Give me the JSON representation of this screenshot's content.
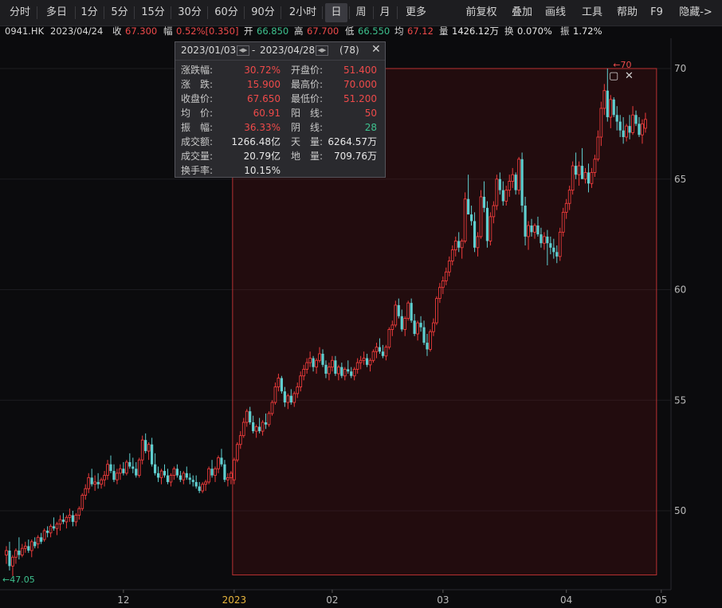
{
  "toolbar": {
    "periods": [
      "分时",
      "多日",
      "1分",
      "5分",
      "15分",
      "30分",
      "60分",
      "90分",
      "2小时",
      "日",
      "周",
      "月",
      "更多"
    ],
    "active_period": "日",
    "right": [
      "前复权",
      "叠加",
      "画线",
      "工具",
      "帮助",
      "F9",
      "隐藏->"
    ]
  },
  "info": {
    "symbol": "0941.HK",
    "date": "2023/04/24",
    "close_label": "收",
    "close": "67.300",
    "amp_label": "幅",
    "amp": "0.52%[0.350]",
    "open_label": "开",
    "open": "66.850",
    "high_label": "高",
    "high": "67.700",
    "low_label": "低",
    "low": "66.550",
    "avg_label": "均",
    "avg": "67.12",
    "vol_label": "量",
    "vol": "1426.12万",
    "turn_label": "换",
    "turn": "0.070%",
    "swing_label": "振",
    "swing": "1.72%"
  },
  "tooltip": {
    "start": "2023/01/03",
    "end": "2023/04/28",
    "count": "(78)",
    "left_rows": [
      {
        "label": "涨跌幅:",
        "value": "30.72%",
        "color": "red"
      },
      {
        "label": "涨　跌:",
        "value": "15.900",
        "color": "red"
      },
      {
        "label": "收盘价:",
        "value": "67.650",
        "color": "red"
      },
      {
        "label": "均　价:",
        "value": "60.91",
        "color": "red"
      },
      {
        "label": "振　幅:",
        "value": "36.33%",
        "color": "red"
      },
      {
        "label": "成交额:",
        "value": "1266.48亿",
        "color": "white"
      },
      {
        "label": "成交量:",
        "value": "20.79亿",
        "color": "white"
      },
      {
        "label": "换手率:",
        "value": "10.15%",
        "color": "white"
      }
    ],
    "right_rows": [
      {
        "label": "开盘价:",
        "value": "51.400",
        "color": "red"
      },
      {
        "label": "最高价:",
        "value": "70.000",
        "color": "red"
      },
      {
        "label": "最低价:",
        "value": "51.200",
        "color": "red"
      },
      {
        "label": "阳　线:",
        "value": "50",
        "color": "red"
      },
      {
        "label": "阴　线:",
        "value": "28",
        "color": "green"
      },
      {
        "label": "天　量:",
        "value": "6264.57万",
        "color": "white"
      },
      {
        "label": "地　量:",
        "value": "709.76万",
        "color": "white"
      }
    ]
  },
  "chart_data": {
    "type": "candlestick",
    "ylim": [
      46.5,
      70.6
    ],
    "y_ticks": [
      50,
      55,
      60,
      65,
      70
    ],
    "x_ticks": [
      {
        "label": "12",
        "index": 37,
        "highlight": false
      },
      {
        "label": "2023",
        "index": 72,
        "highlight": true
      },
      {
        "label": "02",
        "index": 103,
        "highlight": false
      },
      {
        "label": "03",
        "index": 138,
        "highlight": false
      },
      {
        "label": "04",
        "index": 177,
        "highlight": false
      },
      {
        "label": "05",
        "index": 207,
        "highlight": false
      }
    ],
    "annotations": {
      "max_label": "70",
      "max_value": 70.0,
      "max_index": 192,
      "min_label": "47.05",
      "min_value": 47.05,
      "min_index": 2
    },
    "selection": {
      "start_index": 72,
      "end_index": 205,
      "top_value": 70.0,
      "bottom_value": 47.1
    },
    "ohlc": [
      [
        48.0,
        48.4,
        47.6,
        48.2
      ],
      [
        48.2,
        48.6,
        47.3,
        47.5
      ],
      [
        47.5,
        48.0,
        47.05,
        47.9
      ],
      [
        47.9,
        48.3,
        47.6,
        48.2
      ],
      [
        48.2,
        48.8,
        47.8,
        48.0
      ],
      [
        48.0,
        48.5,
        47.9,
        48.3
      ],
      [
        48.3,
        48.6,
        48.1,
        48.4
      ],
      [
        48.4,
        48.7,
        48.1,
        48.2
      ],
      [
        48.2,
        48.7,
        47.9,
        48.6
      ],
      [
        48.6,
        48.8,
        48.3,
        48.4
      ],
      [
        48.5,
        48.9,
        48.3,
        48.8
      ],
      [
        48.8,
        49.0,
        48.5,
        48.6
      ],
      [
        48.7,
        49.2,
        48.6,
        49.1
      ],
      [
        49.1,
        49.3,
        48.8,
        49.0
      ],
      [
        49.0,
        49.4,
        48.8,
        49.3
      ],
      [
        49.3,
        49.7,
        49.1,
        49.2
      ],
      [
        49.2,
        49.5,
        48.9,
        49.4
      ],
      [
        49.4,
        49.8,
        49.1,
        49.6
      ],
      [
        49.6,
        49.9,
        49.4,
        49.5
      ],
      [
        49.5,
        49.8,
        49.2,
        49.7
      ],
      [
        49.7,
        50.1,
        49.5,
        49.8
      ],
      [
        49.8,
        50.0,
        49.3,
        49.5
      ],
      [
        49.5,
        49.9,
        49.3,
        49.8
      ],
      [
        49.8,
        50.2,
        49.6,
        50.1
      ],
      [
        50.1,
        50.8,
        50.0,
        50.7
      ],
      [
        50.7,
        51.2,
        50.5,
        51.0
      ],
      [
        51.0,
        51.7,
        50.8,
        51.5
      ],
      [
        51.5,
        51.9,
        51.1,
        51.2
      ],
      [
        51.2,
        51.6,
        50.9,
        51.3
      ],
      [
        51.3,
        51.7,
        51.0,
        51.2
      ],
      [
        51.2,
        51.5,
        51.0,
        51.4
      ],
      [
        51.4,
        51.8,
        51.1,
        51.6
      ],
      [
        51.6,
        52.3,
        51.4,
        52.1
      ],
      [
        52.1,
        52.5,
        51.7,
        51.8
      ],
      [
        51.8,
        52.1,
        51.3,
        51.4
      ],
      [
        51.4,
        51.9,
        51.2,
        51.7
      ],
      [
        51.7,
        52.1,
        51.4,
        51.9
      ],
      [
        51.9,
        52.2,
        51.6,
        51.7
      ],
      [
        51.7,
        52.3,
        51.6,
        52.2
      ],
      [
        52.2,
        52.6,
        51.9,
        52.0
      ],
      [
        52.0,
        52.4,
        51.7,
        51.9
      ],
      [
        51.9,
        52.2,
        51.5,
        51.6
      ],
      [
        51.6,
        52.4,
        51.5,
        52.3
      ],
      [
        52.3,
        53.4,
        52.1,
        53.2
      ],
      [
        53.2,
        53.5,
        52.6,
        52.7
      ],
      [
        52.7,
        53.1,
        52.3,
        53.0
      ],
      [
        53.0,
        53.3,
        52.0,
        52.1
      ],
      [
        52.1,
        52.6,
        51.6,
        51.7
      ],
      [
        51.7,
        52.0,
        51.3,
        51.5
      ],
      [
        51.5,
        51.9,
        51.2,
        51.8
      ],
      [
        51.8,
        52.1,
        51.5,
        51.6
      ],
      [
        51.6,
        51.9,
        51.2,
        51.3
      ],
      [
        51.3,
        51.7,
        51.1,
        51.6
      ],
      [
        51.6,
        52.0,
        51.4,
        51.9
      ],
      [
        51.9,
        52.1,
        51.5,
        51.6
      ],
      [
        51.6,
        51.8,
        51.3,
        51.4
      ],
      [
        51.4,
        51.8,
        51.2,
        51.7
      ],
      [
        51.7,
        52.0,
        51.4,
        51.5
      ],
      [
        51.5,
        51.7,
        51.2,
        51.4
      ],
      [
        51.4,
        51.6,
        51.1,
        51.3
      ],
      [
        51.3,
        51.6,
        51.0,
        51.1
      ],
      [
        51.1,
        51.3,
        50.8,
        50.9
      ],
      [
        50.9,
        51.3,
        50.8,
        51.2
      ],
      [
        51.2,
        51.4,
        50.9,
        51.3
      ],
      [
        51.3,
        52.0,
        51.2,
        51.9
      ],
      [
        51.9,
        52.3,
        51.5,
        51.6
      ],
      [
        51.6,
        52.0,
        51.3,
        51.9
      ],
      [
        51.9,
        52.5,
        51.7,
        52.4
      ],
      [
        52.4,
        52.8,
        52.0,
        52.1
      ],
      [
        52.1,
        52.3,
        51.3,
        51.4
      ],
      [
        51.4,
        51.7,
        51.1,
        51.5
      ],
      [
        51.5,
        51.8,
        51.2,
        51.7
      ],
      [
        51.4,
        52.4,
        51.2,
        52.3
      ],
      [
        52.3,
        53.1,
        52.2,
        53.0
      ],
      [
        53.0,
        53.6,
        52.8,
        53.4
      ],
      [
        53.4,
        54.2,
        53.3,
        54.0
      ],
      [
        54.0,
        54.6,
        53.8,
        54.5
      ],
      [
        54.5,
        54.7,
        53.9,
        54.0
      ],
      [
        54.0,
        54.3,
        53.5,
        53.6
      ],
      [
        53.6,
        53.9,
        53.3,
        53.8
      ],
      [
        53.8,
        54.2,
        53.5,
        53.6
      ],
      [
        53.6,
        54.1,
        53.4,
        54.0
      ],
      [
        54.0,
        54.4,
        53.7,
        53.9
      ],
      [
        53.9,
        54.5,
        53.8,
        54.4
      ],
      [
        54.4,
        55.0,
        54.3,
        54.9
      ],
      [
        54.9,
        55.8,
        54.8,
        55.6
      ],
      [
        55.6,
        56.2,
        55.4,
        56.0
      ],
      [
        56.0,
        56.1,
        55.3,
        55.4
      ],
      [
        55.4,
        55.6,
        54.7,
        54.9
      ],
      [
        54.9,
        55.3,
        54.6,
        55.2
      ],
      [
        55.2,
        55.5,
        54.8,
        54.9
      ],
      [
        54.9,
        55.4,
        54.7,
        55.3
      ],
      [
        55.3,
        55.8,
        55.1,
        55.6
      ],
      [
        55.6,
        56.3,
        55.4,
        56.1
      ],
      [
        56.1,
        56.6,
        55.9,
        56.4
      ],
      [
        56.4,
        56.9,
        56.2,
        56.7
      ],
      [
        56.7,
        57.2,
        56.5,
        56.9
      ],
      [
        56.9,
        57.0,
        56.3,
        56.5
      ],
      [
        56.5,
        56.9,
        56.2,
        56.8
      ],
      [
        56.8,
        57.4,
        56.7,
        57.1
      ],
      [
        57.1,
        57.3,
        56.5,
        56.6
      ],
      [
        56.6,
        56.8,
        56.0,
        56.2
      ],
      [
        56.2,
        56.7,
        55.9,
        56.5
      ],
      [
        56.5,
        57.0,
        56.3,
        56.8
      ],
      [
        56.8,
        57.0,
        56.1,
        56.2
      ],
      [
        56.2,
        56.6,
        55.9,
        56.5
      ],
      [
        56.5,
        56.7,
        56.0,
        56.1
      ],
      [
        56.1,
        56.5,
        55.9,
        56.4
      ],
      [
        56.4,
        56.8,
        56.2,
        56.3
      ],
      [
        56.3,
        56.5,
        56.0,
        56.1
      ],
      [
        56.1,
        56.5,
        55.9,
        56.4
      ],
      [
        56.4,
        56.9,
        56.2,
        56.7
      ],
      [
        56.7,
        57.0,
        56.4,
        56.8
      ],
      [
        56.8,
        57.2,
        56.6,
        56.9
      ],
      [
        56.9,
        57.1,
        56.5,
        56.6
      ],
      [
        56.6,
        56.9,
        56.3,
        56.8
      ],
      [
        56.8,
        57.3,
        56.7,
        57.2
      ],
      [
        57.2,
        57.6,
        56.9,
        57.4
      ],
      [
        57.4,
        57.8,
        57.1,
        57.2
      ],
      [
        57.2,
        57.5,
        56.9,
        57.0
      ],
      [
        57.0,
        57.5,
        56.8,
        57.4
      ],
      [
        57.4,
        58.3,
        57.3,
        58.2
      ],
      [
        58.2,
        58.6,
        57.9,
        58.4
      ],
      [
        58.4,
        59.5,
        58.3,
        59.3
      ],
      [
        59.3,
        59.6,
        58.7,
        58.8
      ],
      [
        58.8,
        59.1,
        58.1,
        58.2
      ],
      [
        58.2,
        58.8,
        57.9,
        58.7
      ],
      [
        58.7,
        59.5,
        58.6,
        59.4
      ],
      [
        59.4,
        59.6,
        58.5,
        58.6
      ],
      [
        58.6,
        58.9,
        57.9,
        58.0
      ],
      [
        58.0,
        58.6,
        57.7,
        58.5
      ],
      [
        58.5,
        58.8,
        58.1,
        58.3
      ],
      [
        58.3,
        58.6,
        57.5,
        57.6
      ],
      [
        57.6,
        58.0,
        57.0,
        57.3
      ],
      [
        57.3,
        58.2,
        57.2,
        58.1
      ],
      [
        58.1,
        58.7,
        57.9,
        58.5
      ],
      [
        58.5,
        59.7,
        58.4,
        59.6
      ],
      [
        59.6,
        60.3,
        59.4,
        60.1
      ],
      [
        60.1,
        60.6,
        59.8,
        60.4
      ],
      [
        60.4,
        61.0,
        60.2,
        60.8
      ],
      [
        60.8,
        61.5,
        60.6,
        61.3
      ],
      [
        61.3,
        62.0,
        61.1,
        61.8
      ],
      [
        61.8,
        62.4,
        61.5,
        62.2
      ],
      [
        62.2,
        62.6,
        61.7,
        61.9
      ],
      [
        61.9,
        62.3,
        61.4,
        62.2
      ],
      [
        62.2,
        64.4,
        62.1,
        64.1
      ],
      [
        64.1,
        65.2,
        63.8,
        63.4
      ],
      [
        63.4,
        63.8,
        62.9,
        63.1
      ],
      [
        63.1,
        63.5,
        61.7,
        61.9
      ],
      [
        61.9,
        62.6,
        61.5,
        62.4
      ],
      [
        62.4,
        64.5,
        62.3,
        64.2
      ],
      [
        64.2,
        64.9,
        63.5,
        63.7
      ],
      [
        63.7,
        64.0,
        61.9,
        62.2
      ],
      [
        62.2,
        63.5,
        62.0,
        63.3
      ],
      [
        63.3,
        64.0,
        63.0,
        63.8
      ],
      [
        63.8,
        65.2,
        63.6,
        65.0
      ],
      [
        65.0,
        65.3,
        64.3,
        64.5
      ],
      [
        64.5,
        64.9,
        63.8,
        64.0
      ],
      [
        64.0,
        64.7,
        63.8,
        64.5
      ],
      [
        64.5,
        65.2,
        64.2,
        64.9
      ],
      [
        64.9,
        65.5,
        64.6,
        65.2
      ],
      [
        65.2,
        65.3,
        64.3,
        64.5
      ],
      [
        64.5,
        66.0,
        64.3,
        65.9
      ],
      [
        65.9,
        66.2,
        63.5,
        63.8
      ],
      [
        63.8,
        64.2,
        62.0,
        62.4
      ],
      [
        62.4,
        63.1,
        61.8,
        62.9
      ],
      [
        62.9,
        63.2,
        62.4,
        62.6
      ],
      [
        62.6,
        63.0,
        62.3,
        62.9
      ],
      [
        62.9,
        63.3,
        62.4,
        62.5
      ],
      [
        62.5,
        62.8,
        61.9,
        62.1
      ],
      [
        62.1,
        62.6,
        61.8,
        62.4
      ],
      [
        62.4,
        62.7,
        61.1,
        62.1
      ],
      [
        62.1,
        62.4,
        61.6,
        61.9
      ],
      [
        61.9,
        62.3,
        61.4,
        61.7
      ],
      [
        61.7,
        62.0,
        61.2,
        61.5
      ],
      [
        61.5,
        62.8,
        61.3,
        62.6
      ],
      [
        62.6,
        63.7,
        62.4,
        63.5
      ],
      [
        63.5,
        64.1,
        63.2,
        63.9
      ],
      [
        63.9,
        64.7,
        63.6,
        64.5
      ],
      [
        64.5,
        65.8,
        64.3,
        65.6
      ],
      [
        65.6,
        66.2,
        65.0,
        65.2
      ],
      [
        65.2,
        65.8,
        64.7,
        65.6
      ],
      [
        65.6,
        66.4,
        65.3,
        65.0
      ],
      [
        65.0,
        65.5,
        64.8,
        65.3
      ],
      [
        65.3,
        65.7,
        64.4,
        64.8
      ],
      [
        64.8,
        65.5,
        64.6,
        65.3
      ],
      [
        65.3,
        66.1,
        65.1,
        65.9
      ],
      [
        65.9,
        67.2,
        65.8,
        66.9
      ],
      [
        66.9,
        68.5,
        66.5,
        68.2
      ],
      [
        68.2,
        69.3,
        67.9,
        69.0
      ],
      [
        69.0,
        70.0,
        67.6,
        67.8
      ],
      [
        67.8,
        68.8,
        67.3,
        68.6
      ],
      [
        68.6,
        68.7,
        67.8,
        67.9
      ],
      [
        67.9,
        68.3,
        67.2,
        67.6
      ],
      [
        67.6,
        67.9,
        66.9,
        67.2
      ],
      [
        67.2,
        67.8,
        66.6,
        66.9
      ],
      [
        66.9,
        67.5,
        66.7,
        67.4
      ],
      [
        67.4,
        67.9,
        66.8,
        67.1
      ],
      [
        67.1,
        68.3,
        67.0,
        67.9
      ],
      [
        67.9,
        68.1,
        67.4,
        67.5
      ],
      [
        67.5,
        67.8,
        66.9,
        67.0
      ],
      [
        67.0,
        67.7,
        66.6,
        67.5
      ],
      [
        67.3,
        68.0,
        67.1,
        67.7
      ]
    ]
  }
}
